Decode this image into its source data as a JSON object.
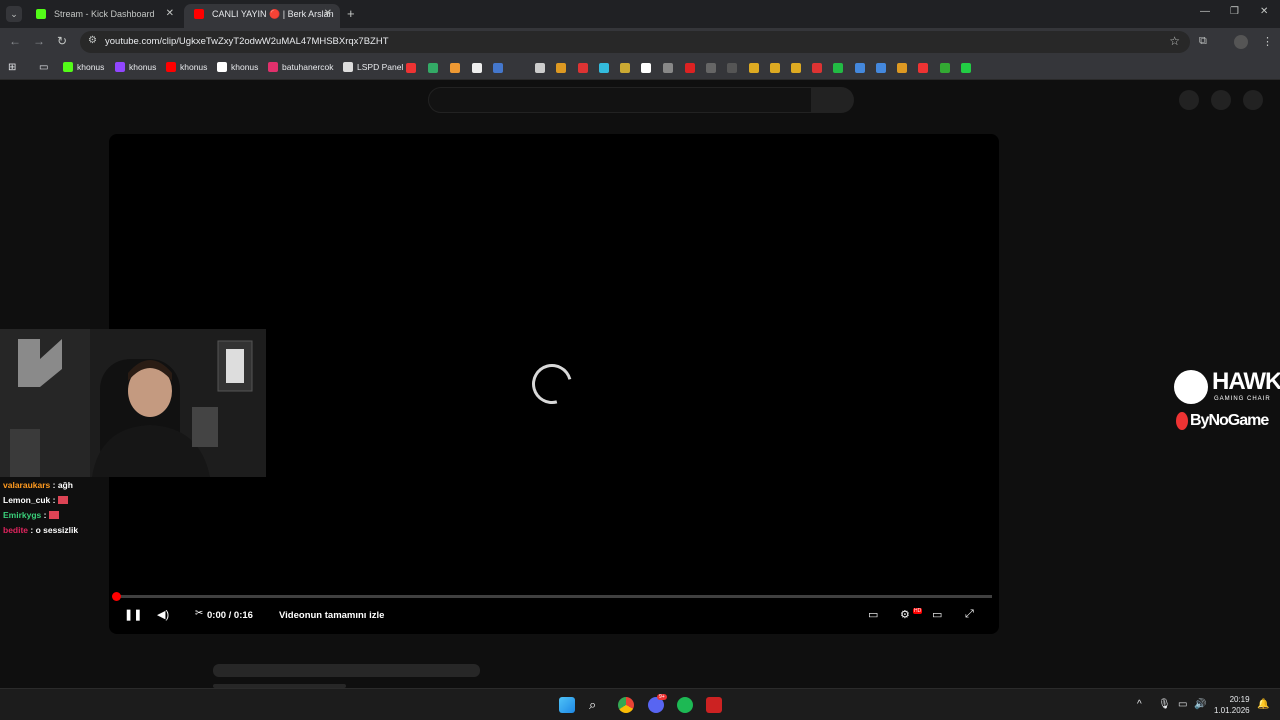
{
  "browser": {
    "tabs": [
      {
        "label": "Stream - Kick Dashboard",
        "favicon_color": "#53fc18",
        "active": false
      },
      {
        "label": "CANLI YAYIN 🔴 | Berk Arslan",
        "favicon_color": "#ff0000",
        "active": true
      }
    ],
    "url": "youtube.com/clip/UgkxeTwZxyT2odwW2uMAL47MHSBXrqx7BZHT",
    "bookmarks": [
      {
        "label": "khonus",
        "color": "#53fc18"
      },
      {
        "label": "khonus",
        "color": "#9146ff"
      },
      {
        "label": "khonus",
        "color": "#ff0000"
      },
      {
        "label": "khonus",
        "color": "#ffffff"
      },
      {
        "label": "batuhanercok",
        "color": "#e1306c"
      },
      {
        "label": "LSPD Panel",
        "color": "#dddddd"
      }
    ]
  },
  "player": {
    "time": "0:00 / 0:16",
    "watch_full": "Videonun tamamını izle",
    "progress": 0,
    "hd_badge": "HD"
  },
  "chat": [
    {
      "user": "valaraukars",
      "sep": " : ",
      "msg": "ağh",
      "color": "#ff9a1f"
    },
    {
      "user": "Lemon_cuk",
      "sep": " : ",
      "msg": "",
      "color": "#ffffff"
    },
    {
      "user": "Emirkygs",
      "sep": " : ",
      "msg": "",
      "color": "#3ad07a"
    },
    {
      "user": "bedite",
      "sep": " : ",
      "msg": "o sessizlik",
      "color": "#e0245e"
    }
  ],
  "sponsor": {
    "brand1": "HAWK",
    "brand1_sub": "GAMING CHAIR",
    "brand2": "ByNoGame"
  },
  "taskbar": {
    "time": "20:19",
    "date": "1.01.2026",
    "discord_badge": "9+"
  },
  "icons": [
    "search-icon",
    "pause-icon",
    "volume-icon",
    "scissors-icon",
    "subtitles-icon",
    "settings-icon",
    "theater-icon",
    "fullscreen-icon",
    "star-icon",
    "extensions-icon"
  ]
}
